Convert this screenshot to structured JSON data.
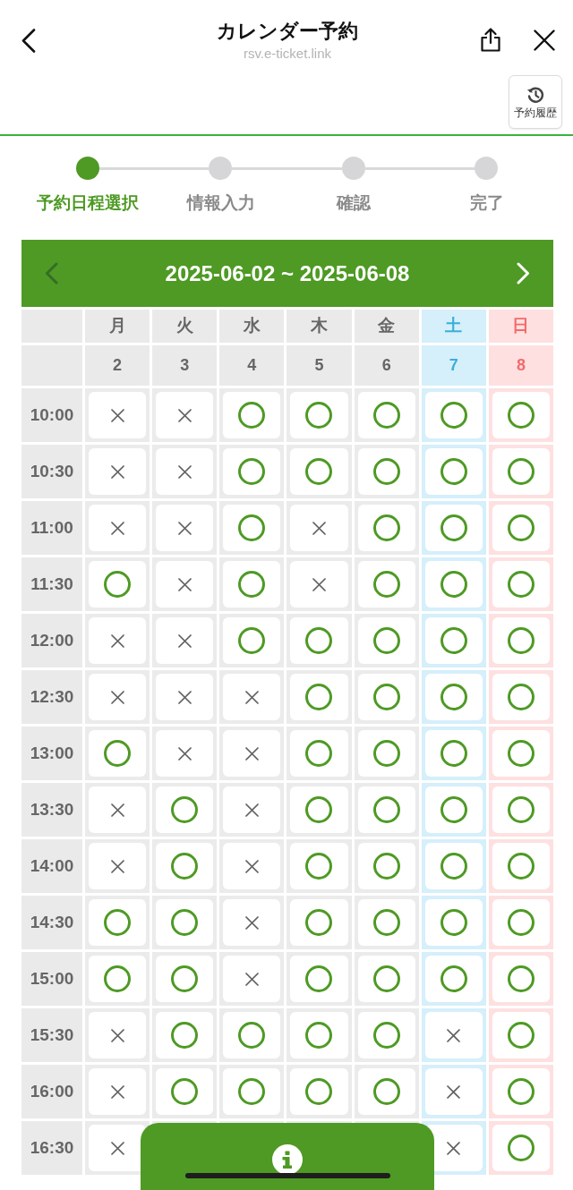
{
  "header": {
    "title": "カレンダー予約",
    "subtitle": "rsv.e-ticket.link"
  },
  "history_button": {
    "label": "予約履歴"
  },
  "steps": [
    {
      "label": "予約日程選択",
      "selected": true
    },
    {
      "label": "情報入力",
      "selected": false
    },
    {
      "label": "確認",
      "selected": false
    },
    {
      "label": "完了",
      "selected": false
    }
  ],
  "calendar": {
    "range": "2025-06-02 ~ 2025-06-08",
    "prev": {
      "disabled": true
    },
    "next": {
      "disabled": false
    },
    "days": [
      {
        "weekday": "月",
        "date": "2",
        "kind": "weekday"
      },
      {
        "weekday": "火",
        "date": "3",
        "kind": "weekday"
      },
      {
        "weekday": "水",
        "date": "4",
        "kind": "weekday"
      },
      {
        "weekday": "木",
        "date": "5",
        "kind": "weekday"
      },
      {
        "weekday": "金",
        "date": "6",
        "kind": "weekday"
      },
      {
        "weekday": "土",
        "date": "7",
        "kind": "saturday"
      },
      {
        "weekday": "日",
        "date": "8",
        "kind": "sunday"
      }
    ],
    "rows": [
      {
        "time": "10:00",
        "slots": [
          {
            "available": false
          },
          {
            "available": false
          },
          {
            "available": true
          },
          {
            "available": true
          },
          {
            "available": true
          },
          {
            "available": true
          },
          {
            "available": true
          }
        ]
      },
      {
        "time": "10:30",
        "slots": [
          {
            "available": false
          },
          {
            "available": false
          },
          {
            "available": true
          },
          {
            "available": true
          },
          {
            "available": true
          },
          {
            "available": true
          },
          {
            "available": true
          }
        ]
      },
      {
        "time": "11:00",
        "slots": [
          {
            "available": false
          },
          {
            "available": false
          },
          {
            "available": true
          },
          {
            "available": false
          },
          {
            "available": true
          },
          {
            "available": true
          },
          {
            "available": true
          }
        ]
      },
      {
        "time": "11:30",
        "slots": [
          {
            "available": true
          },
          {
            "available": false
          },
          {
            "available": true
          },
          {
            "available": false
          },
          {
            "available": true
          },
          {
            "available": true
          },
          {
            "available": true
          }
        ]
      },
      {
        "time": "12:00",
        "slots": [
          {
            "available": false
          },
          {
            "available": false
          },
          {
            "available": true
          },
          {
            "available": true
          },
          {
            "available": true
          },
          {
            "available": true
          },
          {
            "available": true
          }
        ]
      },
      {
        "time": "12:30",
        "slots": [
          {
            "available": false
          },
          {
            "available": false
          },
          {
            "available": false
          },
          {
            "available": true
          },
          {
            "available": true
          },
          {
            "available": true
          },
          {
            "available": true
          }
        ]
      },
      {
        "time": "13:00",
        "slots": [
          {
            "available": true
          },
          {
            "available": false
          },
          {
            "available": false
          },
          {
            "available": true
          },
          {
            "available": true
          },
          {
            "available": true
          },
          {
            "available": true
          }
        ]
      },
      {
        "time": "13:30",
        "slots": [
          {
            "available": false
          },
          {
            "available": true
          },
          {
            "available": false
          },
          {
            "available": true
          },
          {
            "available": true
          },
          {
            "available": true
          },
          {
            "available": true
          }
        ]
      },
      {
        "time": "14:00",
        "slots": [
          {
            "available": false
          },
          {
            "available": true
          },
          {
            "available": false
          },
          {
            "available": true
          },
          {
            "available": true
          },
          {
            "available": true
          },
          {
            "available": true
          }
        ]
      },
      {
        "time": "14:30",
        "slots": [
          {
            "available": true
          },
          {
            "available": true
          },
          {
            "available": false
          },
          {
            "available": true
          },
          {
            "available": true
          },
          {
            "available": true
          },
          {
            "available": true
          }
        ]
      },
      {
        "time": "15:00",
        "slots": [
          {
            "available": true
          },
          {
            "available": true
          },
          {
            "available": false
          },
          {
            "available": true
          },
          {
            "available": true
          },
          {
            "available": true
          },
          {
            "available": true
          }
        ]
      },
      {
        "time": "15:30",
        "slots": [
          {
            "available": false
          },
          {
            "available": true
          },
          {
            "available": true
          },
          {
            "available": true
          },
          {
            "available": true
          },
          {
            "available": false
          },
          {
            "available": true
          }
        ]
      },
      {
        "time": "16:00",
        "slots": [
          {
            "available": false
          },
          {
            "available": true
          },
          {
            "available": true
          },
          {
            "available": true
          },
          {
            "available": true
          },
          {
            "available": false
          },
          {
            "available": true
          }
        ]
      },
      {
        "time": "16:30",
        "slots": [
          {
            "available": false
          }
        ],
        "trailing_slots": [
          {
            "available": false
          },
          {
            "available": true
          }
        ]
      }
    ]
  }
}
